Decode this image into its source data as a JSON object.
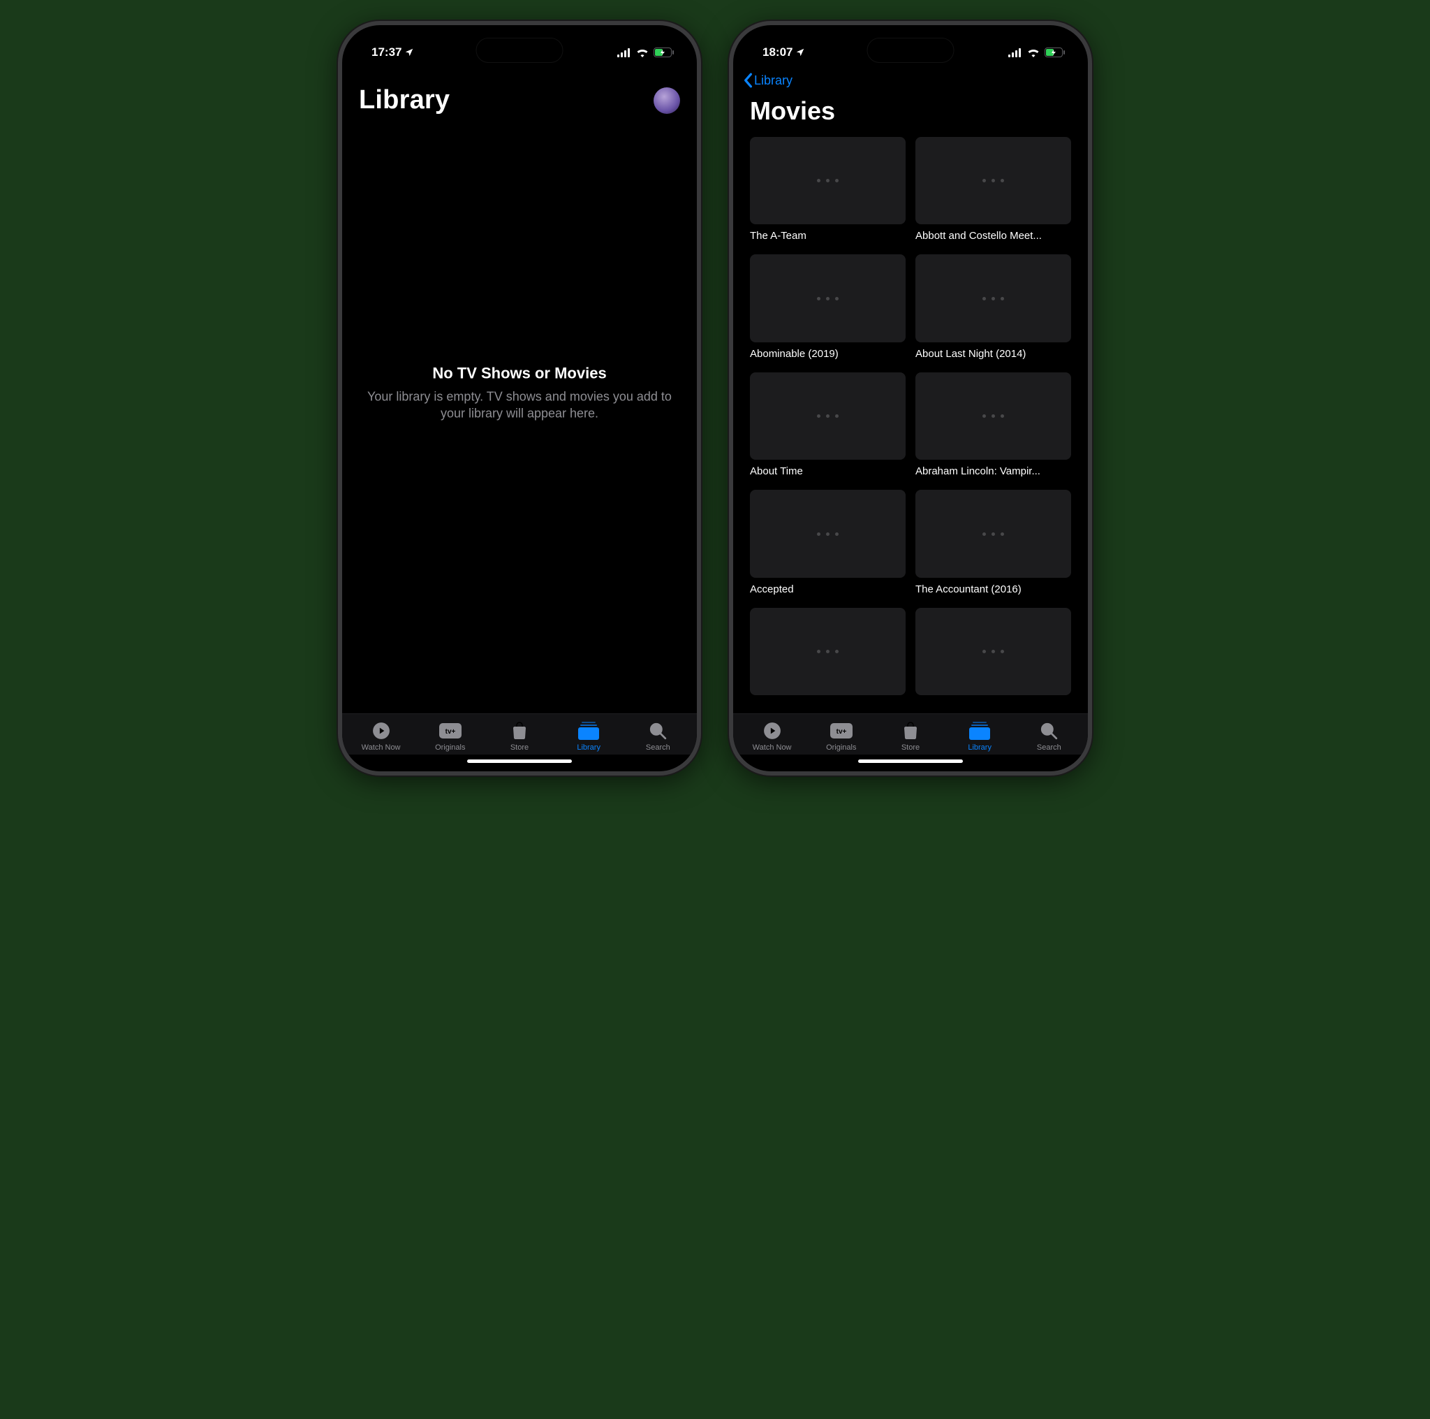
{
  "left": {
    "status": {
      "time": "17:37"
    },
    "title": "Library",
    "empty": {
      "title": "No TV Shows or Movies",
      "subtitle": "Your library is empty. TV shows and movies you add to your library will appear here."
    }
  },
  "right": {
    "status": {
      "time": "18:07"
    },
    "back_label": "Library",
    "title": "Movies",
    "movies": [
      {
        "title": "The A-Team"
      },
      {
        "title": "Abbott and Costello Meet..."
      },
      {
        "title": "Abominable (2019)"
      },
      {
        "title": "About Last Night (2014)"
      },
      {
        "title": "About Time"
      },
      {
        "title": "Abraham Lincoln: Vampir..."
      },
      {
        "title": "Accepted"
      },
      {
        "title": "The Accountant (2016)"
      },
      {
        "title": ""
      },
      {
        "title": ""
      }
    ]
  },
  "tabs": [
    {
      "id": "watch-now",
      "label": "Watch Now"
    },
    {
      "id": "originals",
      "label": "Originals"
    },
    {
      "id": "store",
      "label": "Store"
    },
    {
      "id": "library",
      "label": "Library",
      "active": true
    },
    {
      "id": "search",
      "label": "Search"
    }
  ],
  "colors": {
    "accent": "#0a84ff"
  }
}
